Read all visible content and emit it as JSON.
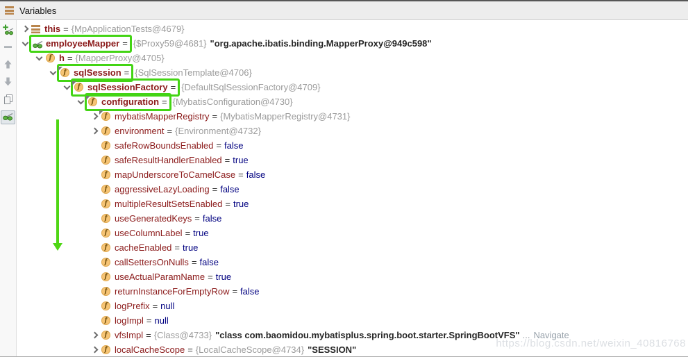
{
  "panel": {
    "title": "Variables"
  },
  "toolbar": {
    "buttons": [
      {
        "id": "add-watch",
        "icon": "add-watch-icon",
        "enabled": true,
        "selected": false
      },
      {
        "id": "remove",
        "icon": "remove-minus-icon",
        "enabled": false,
        "selected": false
      },
      {
        "id": "move-up",
        "icon": "arrow-up-icon",
        "enabled": false,
        "selected": false
      },
      {
        "id": "move-down",
        "icon": "arrow-down-icon",
        "enabled": false,
        "selected": false
      },
      {
        "id": "duplicate",
        "icon": "copy-icon",
        "enabled": true,
        "selected": false
      },
      {
        "id": "show-watches",
        "icon": "show-watches-glasses-icon",
        "enabled": true,
        "selected": true
      }
    ]
  },
  "tree": {
    "equals": "=",
    "rows": [
      {
        "name": "this",
        "level": 0,
        "state": "collapsed",
        "icon": "vars",
        "bold": true,
        "ref": "{MpApplicationTests@4679}"
      },
      {
        "name": "employeeMapper",
        "level": 0,
        "state": "expanded",
        "icon": "watch",
        "bold": true,
        "highlight": true,
        "ref": "{$Proxy59@4681}",
        "str": "\"org.apache.ibatis.binding.MapperProxy@949c598\""
      },
      {
        "name": "h",
        "level": 1,
        "state": "expanded",
        "icon": "field",
        "bold": true,
        "ref": "{MapperProxy@4705}"
      },
      {
        "name": "sqlSession",
        "level": 2,
        "state": "expanded",
        "icon": "field-final",
        "bold": true,
        "highlight": true,
        "ref": "{SqlSessionTemplate@4706}"
      },
      {
        "name": "sqlSessionFactory",
        "level": 3,
        "state": "expanded",
        "icon": "field-final",
        "bold": true,
        "highlight": true,
        "ref": "{DefaultSqlSessionFactory@4709}"
      },
      {
        "name": "configuration",
        "level": 4,
        "state": "expanded",
        "icon": "field-final",
        "bold": true,
        "highlight": true,
        "ref": "{MybatisConfiguration@4730}"
      },
      {
        "name": "mybatisMapperRegistry",
        "level": 5,
        "state": "collapsed",
        "icon": "field-final",
        "ref": "{MybatisMapperRegistry@4731}"
      },
      {
        "name": "environment",
        "level": 5,
        "state": "collapsed",
        "icon": "field",
        "ref": "{Environment@4732}"
      },
      {
        "name": "safeRowBoundsEnabled",
        "level": 5,
        "state": "leaf",
        "icon": "field",
        "kw": "false"
      },
      {
        "name": "safeResultHandlerEnabled",
        "level": 5,
        "state": "leaf",
        "icon": "field",
        "kw": "true"
      },
      {
        "name": "mapUnderscoreToCamelCase",
        "level": 5,
        "state": "leaf",
        "icon": "field",
        "kw": "false"
      },
      {
        "name": "aggressiveLazyLoading",
        "level": 5,
        "state": "leaf",
        "icon": "field",
        "kw": "false"
      },
      {
        "name": "multipleResultSetsEnabled",
        "level": 5,
        "state": "leaf",
        "icon": "field",
        "kw": "true"
      },
      {
        "name": "useGeneratedKeys",
        "level": 5,
        "state": "leaf",
        "icon": "field",
        "kw": "false"
      },
      {
        "name": "useColumnLabel",
        "level": 5,
        "state": "leaf",
        "icon": "field",
        "kw": "true"
      },
      {
        "name": "cacheEnabled",
        "level": 5,
        "state": "leaf",
        "icon": "field",
        "kw": "true"
      },
      {
        "name": "callSettersOnNulls",
        "level": 5,
        "state": "leaf",
        "icon": "field",
        "kw": "false"
      },
      {
        "name": "useActualParamName",
        "level": 5,
        "state": "leaf",
        "icon": "field",
        "kw": "true"
      },
      {
        "name": "returnInstanceForEmptyRow",
        "level": 5,
        "state": "leaf",
        "icon": "field",
        "kw": "false"
      },
      {
        "name": "logPrefix",
        "level": 5,
        "state": "leaf",
        "icon": "field",
        "kw": "null"
      },
      {
        "name": "logImpl",
        "level": 5,
        "state": "leaf",
        "icon": "field",
        "kw": "null"
      },
      {
        "name": "vfsImpl",
        "level": 5,
        "state": "collapsed",
        "icon": "field",
        "ref": "{Class@4733}",
        "str": "\"class com.baomidou.mybatisplus.spring.boot.starter.SpringBootVFS\"",
        "more": "...",
        "link": "Navigate"
      },
      {
        "name": "localCacheScope",
        "level": 5,
        "state": "collapsed",
        "icon": "field",
        "ref": "{LocalCacheScope@4734}",
        "str": "\"SESSION\""
      }
    ]
  },
  "watermark": "https://blog.csdn.net/weixin_40816768"
}
